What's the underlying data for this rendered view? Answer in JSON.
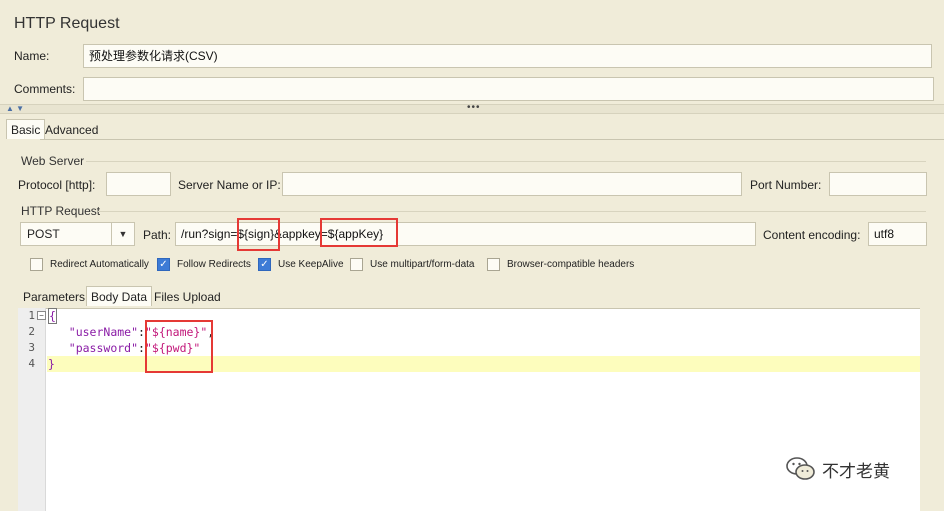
{
  "header": {
    "title": "HTTP Request"
  },
  "name": {
    "label": "Name:",
    "value": "预处理参数化请求(CSV)"
  },
  "comments": {
    "label": "Comments:",
    "value": ""
  },
  "tabs": [
    {
      "label": "Basic",
      "active": true
    },
    {
      "label": "Advanced",
      "active": false
    }
  ],
  "web_server": {
    "title": "Web Server",
    "protocol_label": "Protocol [http]:",
    "protocol_value": "",
    "server_label": "Server Name or IP:",
    "server_value": "",
    "port_label": "Port Number:",
    "port_value": ""
  },
  "http_request": {
    "title": "HTTP Request",
    "method": "POST",
    "path_label": "Path:",
    "path_value": "/run?sign=${sign}&appkey=${appKey}",
    "encoding_label": "Content encoding:",
    "encoding_value": "utf8"
  },
  "checkboxes": [
    {
      "label": "Redirect Automatically",
      "checked": false
    },
    {
      "label": "Follow Redirects",
      "checked": true
    },
    {
      "label": "Use KeepAlive",
      "checked": true
    },
    {
      "label": "Use multipart/form-data",
      "checked": false
    },
    {
      "label": "Browser-compatible headers",
      "checked": false
    }
  ],
  "body_tabs": [
    {
      "label": "Parameters",
      "active": false
    },
    {
      "label": "Body Data",
      "active": true
    },
    {
      "label": "Files Upload",
      "active": false
    }
  ],
  "editor": {
    "line_numbers": [
      "1",
      "2",
      "3",
      "4"
    ],
    "line1": "{",
    "line2_key": "\"userName\"",
    "line2_colon": ":",
    "line2_value": "\"${name}\"",
    "line2_comma": ",",
    "line3_key": "\"password\"",
    "line3_colon": ":",
    "line3_value": "\"${pwd}\"",
    "line4": "}"
  },
  "watermark": {
    "text": "不才老黄"
  },
  "colors": {
    "highlight_box": "#e53935",
    "checkbox_checked": "#3d7bd6",
    "json_key": "#8a1ca6",
    "json_string": "#c2187a"
  }
}
